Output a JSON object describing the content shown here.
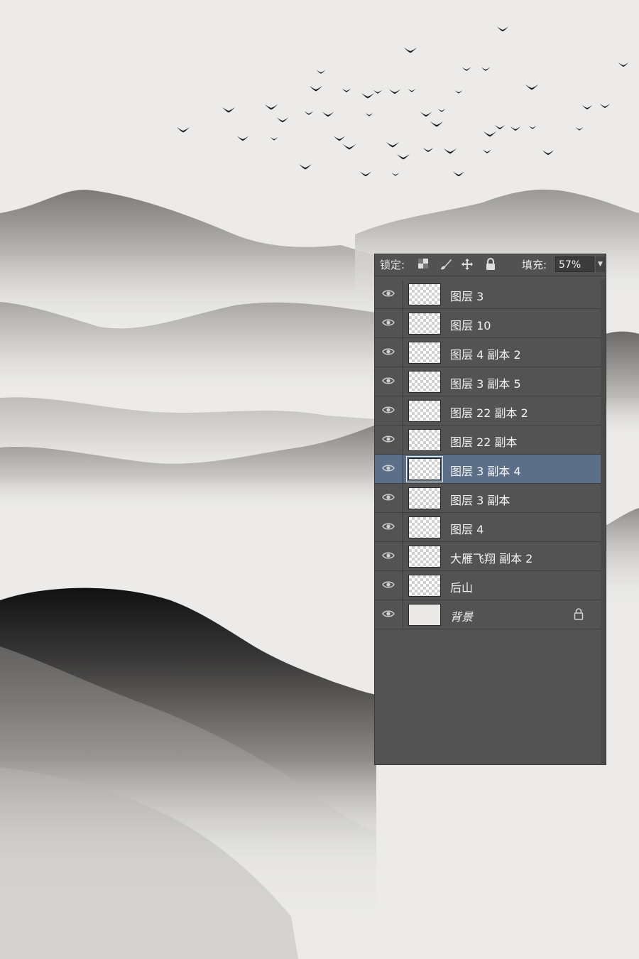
{
  "panel": {
    "lock_label": "锁定:",
    "lock_icons": [
      "lock-transparent-pixels-icon",
      "lock-image-pixels-icon",
      "lock-position-icon",
      "lock-all-icon"
    ],
    "fill_label": "填充:",
    "fill_value": "57%"
  },
  "layers": [
    {
      "name": "图层 3",
      "selected": false,
      "locked": false
    },
    {
      "name": "图层 10",
      "selected": false,
      "locked": false
    },
    {
      "name": "图层 4 副本 2",
      "selected": false,
      "locked": false
    },
    {
      "name": "图层 3 副本 5",
      "selected": false,
      "locked": false
    },
    {
      "name": "图层 22 副本 2",
      "selected": false,
      "locked": false
    },
    {
      "name": "图层 22 副本",
      "selected": false,
      "locked": false
    },
    {
      "name": "图层 3 副本 4",
      "selected": true,
      "locked": false
    },
    {
      "name": "图层 3 副本",
      "selected": false,
      "locked": false
    },
    {
      "name": "图层 4",
      "selected": false,
      "locked": false
    },
    {
      "name": "大雁飞翔 副本 2",
      "selected": false,
      "locked": false
    },
    {
      "name": "后山",
      "selected": false,
      "locked": false
    },
    {
      "name": "背景",
      "selected": false,
      "locked": true
    }
  ],
  "colors": {
    "background": "#ecebe9",
    "panel": "#535353",
    "selected_row": "#5b6f89",
    "ink_dark": "#1a1a1a"
  }
}
